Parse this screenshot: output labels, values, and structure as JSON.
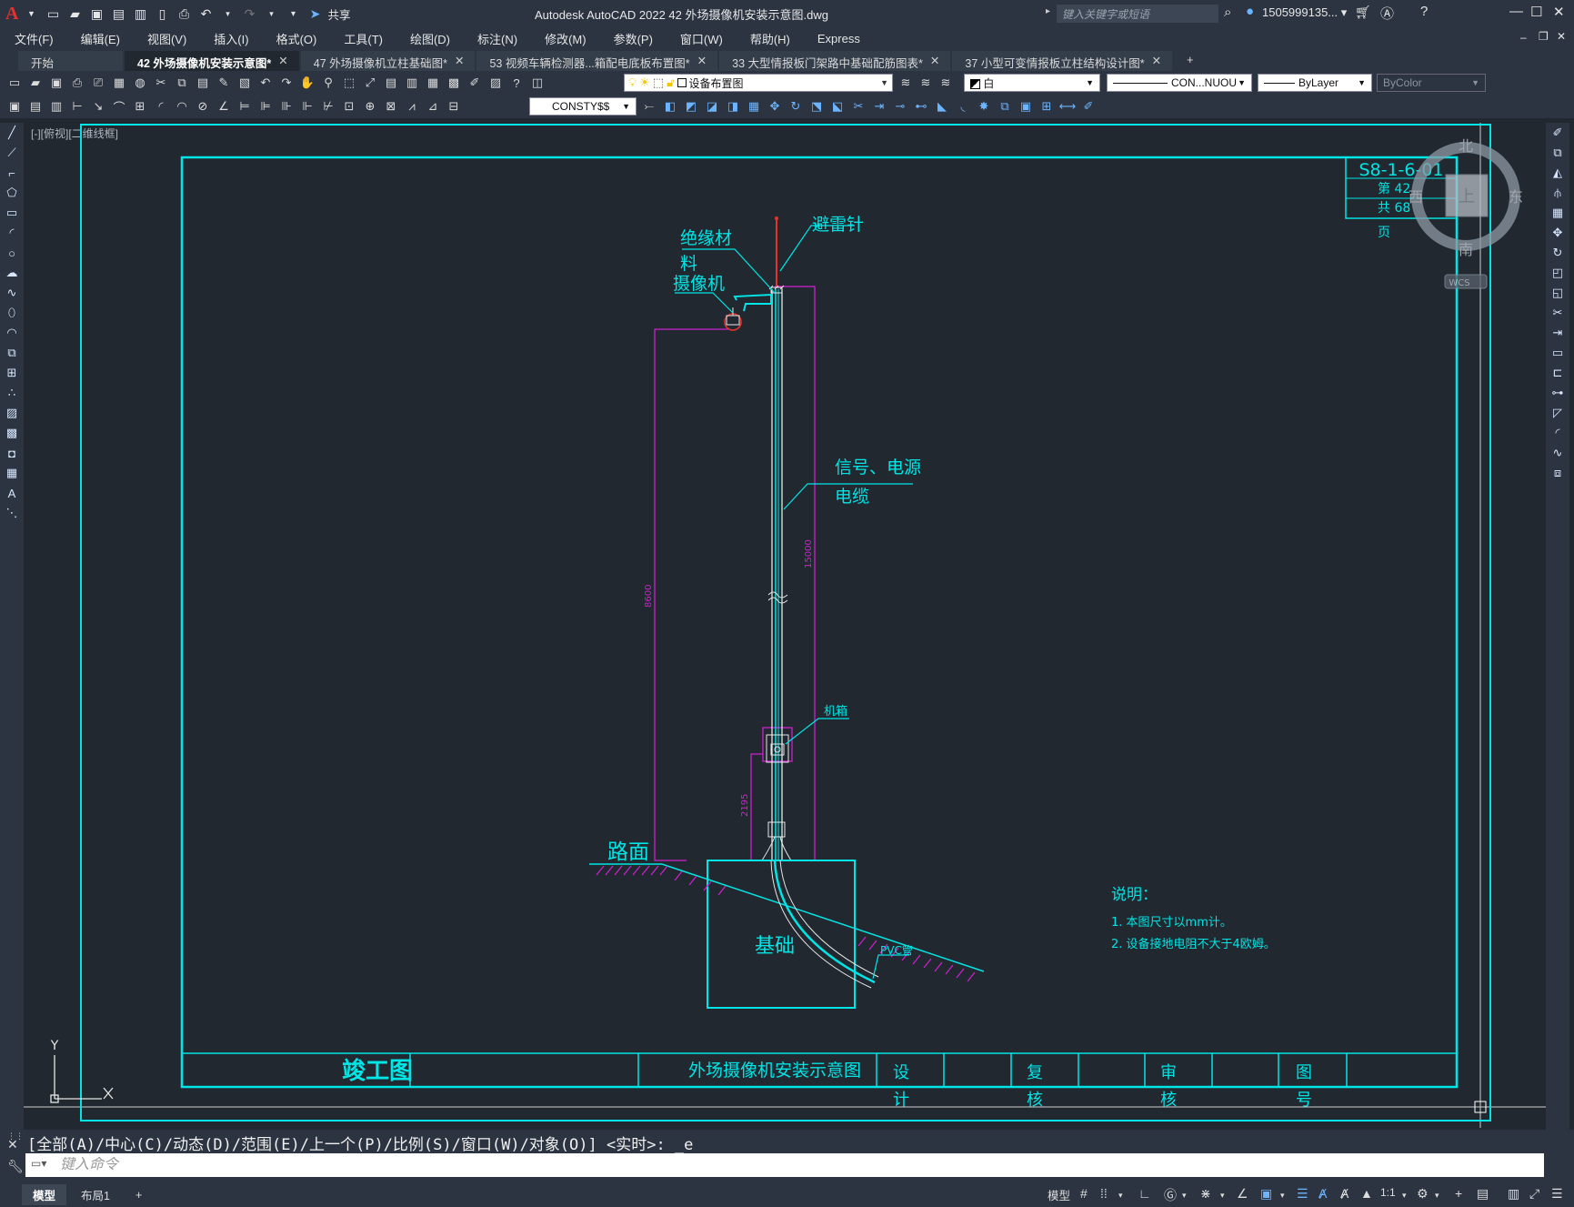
{
  "app": {
    "title": "Autodesk AutoCAD 2022    42   外场摄像机安装示意图.dwg",
    "share_label": "共享",
    "search_placeholder": "键入关键字或短语",
    "user": "1505999135... ▾",
    "accent": "#e5322d"
  },
  "menu": [
    "文件(F)",
    "编辑(E)",
    "视图(V)",
    "插入(I)",
    "格式(O)",
    "工具(T)",
    "绘图(D)",
    "标注(N)",
    "修改(M)",
    "参数(P)",
    "窗口(W)",
    "帮助(H)",
    "Express"
  ],
  "tabs": [
    {
      "label": "开始",
      "active": false,
      "closable": false
    },
    {
      "label": "42   外场摄像机安装示意图*",
      "active": true,
      "closable": true
    },
    {
      "label": "47   外场摄像机立柱基础图*",
      "active": false,
      "closable": true
    },
    {
      "label": "53   视频车辆检测器...箱配电底板布置图*",
      "active": false,
      "closable": true
    },
    {
      "label": "33   大型情报板门架路中基础配筋图表*",
      "active": false,
      "closable": true
    },
    {
      "label": "37   小型可变情报板立柱结构设计图*",
      "active": false,
      "closable": true
    }
  ],
  "toolbar": {
    "layer": "设备布置图",
    "color": "白",
    "linetype": "CON...NUOU",
    "lineweight": "ByLayer",
    "plotstyle": "ByColor",
    "dimstyle": "CONSTY$$"
  },
  "viewport": {
    "label": "[-][俯视][二维线框]",
    "viewcube": {
      "north": "北",
      "south": "南",
      "east": "东",
      "west": "西",
      "top": "上",
      "wcs": "WCS"
    },
    "ucs_y": "Y"
  },
  "drawing": {
    "sheet_code": "S8-1-6-01",
    "page_line": "第 42",
    "total_line": "共 68",
    "page_unit": "页",
    "labels": {
      "lightning_rod": "避雷针",
      "insulation": "绝缘材",
      "insulation2": "料",
      "camera": "摄像机",
      "cable1": "信号、电源",
      "cable2": "电缆",
      "cabinet": "机箱",
      "road": "路面",
      "foundation": "基础",
      "pvc": "PVC管",
      "dim_total": "8600",
      "dim_upper": "15000",
      "dim_lower": "2195"
    },
    "notes": {
      "title": "说明：",
      "items": [
        "1. 本图尺寸以mm计。",
        "2. 设备接地电阻不大于4欧姆。"
      ]
    },
    "title_block": {
      "stamp": "竣工图",
      "drawing_name": "外场摄像机安装示意图",
      "design_a": "设",
      "design_b": "计",
      "review_a": "复",
      "review_b": "核",
      "approve_a": "审",
      "approve_b": "核",
      "number_a": "图",
      "number_b": "号"
    },
    "colors": {
      "frame": "#00e5e5",
      "dimension": "#d020d0",
      "pole": "#e6e6e6",
      "hatch": "#d020d0",
      "text": "#00e5e5",
      "rod": "#e5322d"
    }
  },
  "command": {
    "history": "[全部(A)/中心(C)/动态(D)/范围(E)/上一个(P)/比例(S)/窗口(W)/对象(O)] <实时>: _e",
    "placeholder": "键入命令"
  },
  "status": {
    "layouts": [
      "模型",
      "布局1"
    ],
    "model_button": "模型",
    "scale": "1:1"
  }
}
